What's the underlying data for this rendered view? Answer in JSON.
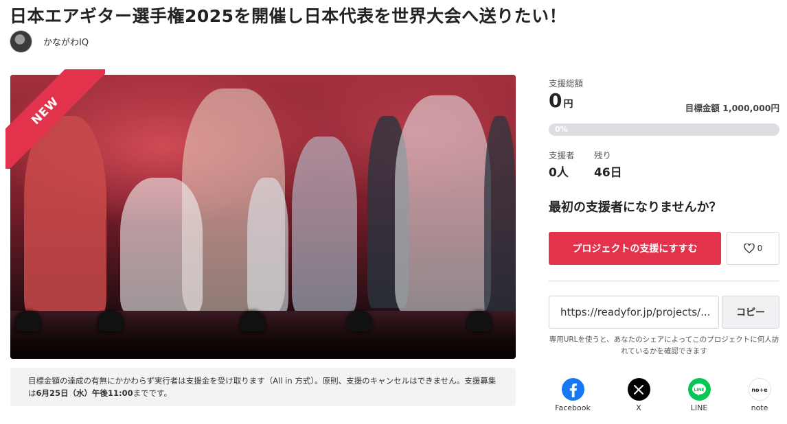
{
  "project": {
    "title": "日本エアギター選手権2025を開催し日本代表を世界大会へ送りたい！",
    "owner": "かながわIQ",
    "badge": "NEW"
  },
  "notice": {
    "part1": "目標金額の達成の有無にかかわらず実行者は支援金を受け取ります（All in 方式）。原則、支援のキャンセルはできません。支援募集は",
    "deadline": "6月25日（水）午後11:00",
    "part2": "までです。"
  },
  "funding": {
    "total_label": "支援総額",
    "total_amount": "0",
    "currency": "円",
    "goal": "目標金額 1,000,000円",
    "progress_text": "0%",
    "progress": 0,
    "supporters_label": "支援者",
    "supporters_value": "0人",
    "remaining_label": "残り",
    "remaining_value": "46日"
  },
  "cta": {
    "question": "最初の支援者になりませんか？",
    "support_button": "プロジェクトの支援にすすむ",
    "like_count": "0"
  },
  "share": {
    "url": "https://readyfor.jp/projects/...",
    "copy_button": "コピー",
    "note": "専用URLを使うと、あなたのシェアによってこのプロジェクトに何人訪れているかを確認できます",
    "services": [
      {
        "name": "Facebook",
        "icon": "facebook-icon",
        "color": "#1877f2"
      },
      {
        "name": "X",
        "icon": "x-icon",
        "color": "#000000"
      },
      {
        "name": "LINE",
        "icon": "line-icon",
        "color": "#06c755"
      },
      {
        "name": "note",
        "icon": "note-icon",
        "color": "#ffffff"
      }
    ]
  },
  "colors": {
    "accent": "#e3324b",
    "progress_bg": "#dcdee2",
    "notice_bg": "#f2f3f5"
  }
}
